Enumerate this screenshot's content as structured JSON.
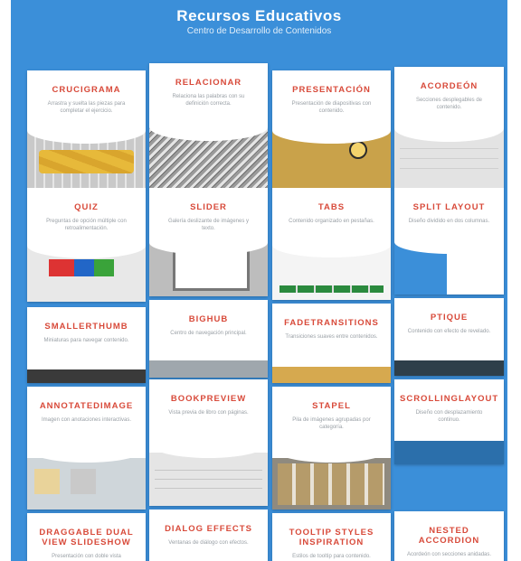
{
  "header": {
    "title": "Recursos Educativos",
    "subtitle": "Centro de Desarrollo de Contenidos"
  },
  "cards": [
    {
      "name": "CRUCIGRAMA",
      "desc": "Arrastra y suelta las piezas para completar el ejercicio."
    },
    {
      "name": "RELACIONAR",
      "desc": "Relaciona las palabras con su definición correcta."
    },
    {
      "name": "PRESENTACIÓN",
      "desc": "Presentación de diapositivas con contenido."
    },
    {
      "name": "ACORDEÓN",
      "desc": "Secciones desplegables de contenido."
    },
    {
      "name": "QUIZ",
      "desc": "Preguntas de opción múltiple con retroalimentación."
    },
    {
      "name": "SLIDER",
      "desc": "Galería deslizante de imágenes y texto."
    },
    {
      "name": "TABS",
      "desc": "Contenido organizado en pestañas."
    },
    {
      "name": "SPLIT LAYOUT",
      "desc": "Diseño dividido en dos columnas."
    },
    {
      "name": "SMALLERTHUMB",
      "desc": "Miniaturas para navegar contenido."
    },
    {
      "name": "BIGHUB",
      "desc": "Centro de navegación principal."
    },
    {
      "name": "FADETRANSITIONS",
      "desc": "Transiciones suaves entre contenidos."
    },
    {
      "name": "PTIQUE",
      "desc": "Contenido con efecto de revelado."
    },
    {
      "name": "ANNOTATEDIMAGE",
      "desc": "Imagen con anotaciones interactivas."
    },
    {
      "name": "BOOKPREVIEW",
      "desc": "Vista previa de libro con páginas."
    },
    {
      "name": "STAPEL",
      "desc": "Pila de imágenes agrupadas por categoría."
    },
    {
      "name": "SCROLLINGLAYOUT",
      "desc": "Diseño con desplazamiento continuo."
    },
    {
      "name": "DRAGGABLE DUAL VIEW SLIDESHOW",
      "desc": "Presentación con doble vista arrastrable."
    },
    {
      "name": "DIALOG EFFECTS",
      "desc": "Ventanas de diálogo con efectos."
    },
    {
      "name": "TOOLTIP STYLES INSPIRATION",
      "desc": "Estilos de tooltip para contenido."
    },
    {
      "name": "NESTED ACCORDION",
      "desc": "Acordeón con secciones anidadas."
    }
  ]
}
